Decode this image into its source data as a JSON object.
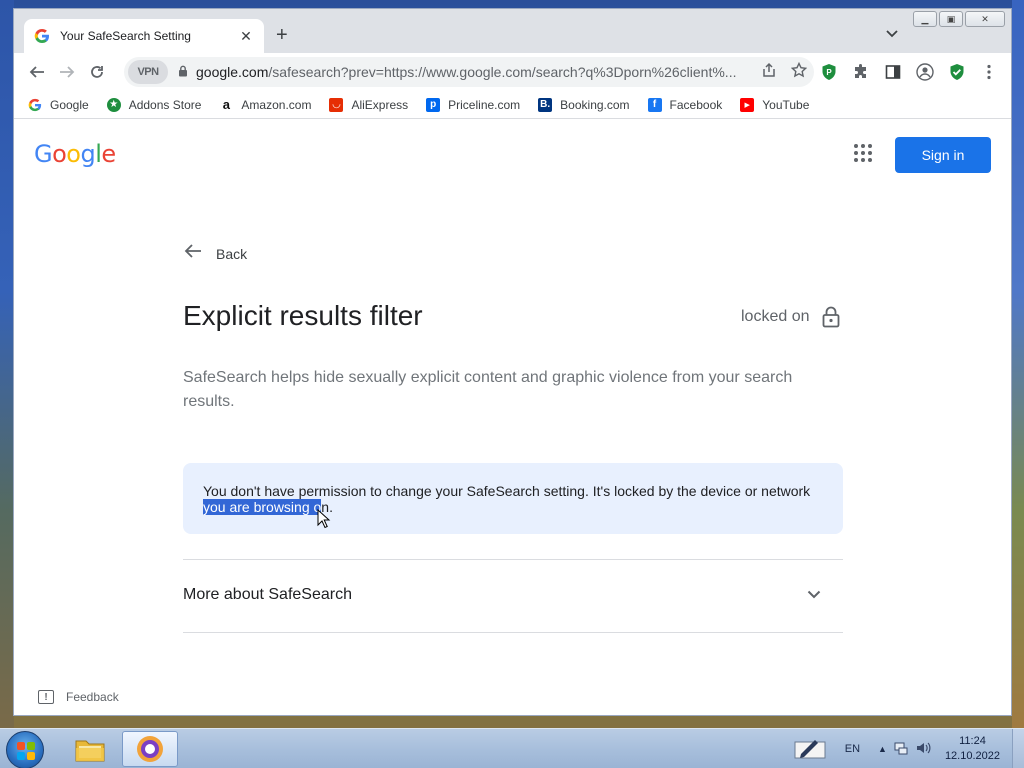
{
  "browser": {
    "tab": {
      "title": "Your SafeSearch Setting",
      "close": "✕"
    },
    "new_tab": "+",
    "window_controls": {
      "minimize": "▁",
      "maximize": "▣",
      "close": "✕"
    },
    "omnibox": {
      "vpn_label": "VPN",
      "url_host": "google.com",
      "url_rest": "/safesearch?prev=https://www.google.com/search?q%3Dporn%26client%..."
    },
    "bookmarks": [
      {
        "label": "Google",
        "icon": "google-icon",
        "color": "#ffffff"
      },
      {
        "label": "Addons Store",
        "icon": "addons-store-icon",
        "color": "#1e8e3e"
      },
      {
        "label": "Amazon.com",
        "icon": "amazon-icon",
        "color": "#ffffff"
      },
      {
        "label": "AliExpress",
        "icon": "aliexpress-icon",
        "color": "#e62e04"
      },
      {
        "label": "Priceline.com",
        "icon": "priceline-icon",
        "color": "#0068ef"
      },
      {
        "label": "Booking.com",
        "icon": "booking-icon",
        "color": "#003580"
      },
      {
        "label": "Facebook",
        "icon": "facebook-icon",
        "color": "#1877f2"
      },
      {
        "label": "YouTube",
        "icon": "youtube-icon",
        "color": "#ff0000"
      }
    ]
  },
  "page": {
    "sign_in": "Sign in",
    "back": "Back",
    "title": "Explicit results filter",
    "status": "locked on",
    "description": "SafeSearch helps hide sexually explicit content and graphic violence from your search results.",
    "notice_before": "You don't have permission to change your SafeSearch setting. It's locked by the device or network ",
    "notice_selected": "you are browsing o",
    "notice_after": "n.",
    "more_about": "More about SafeSearch",
    "feedback": "Feedback",
    "accent_color": "#1a73e8"
  },
  "taskbar": {
    "language": "EN",
    "time": "11:24",
    "date": "12.10.2022"
  }
}
